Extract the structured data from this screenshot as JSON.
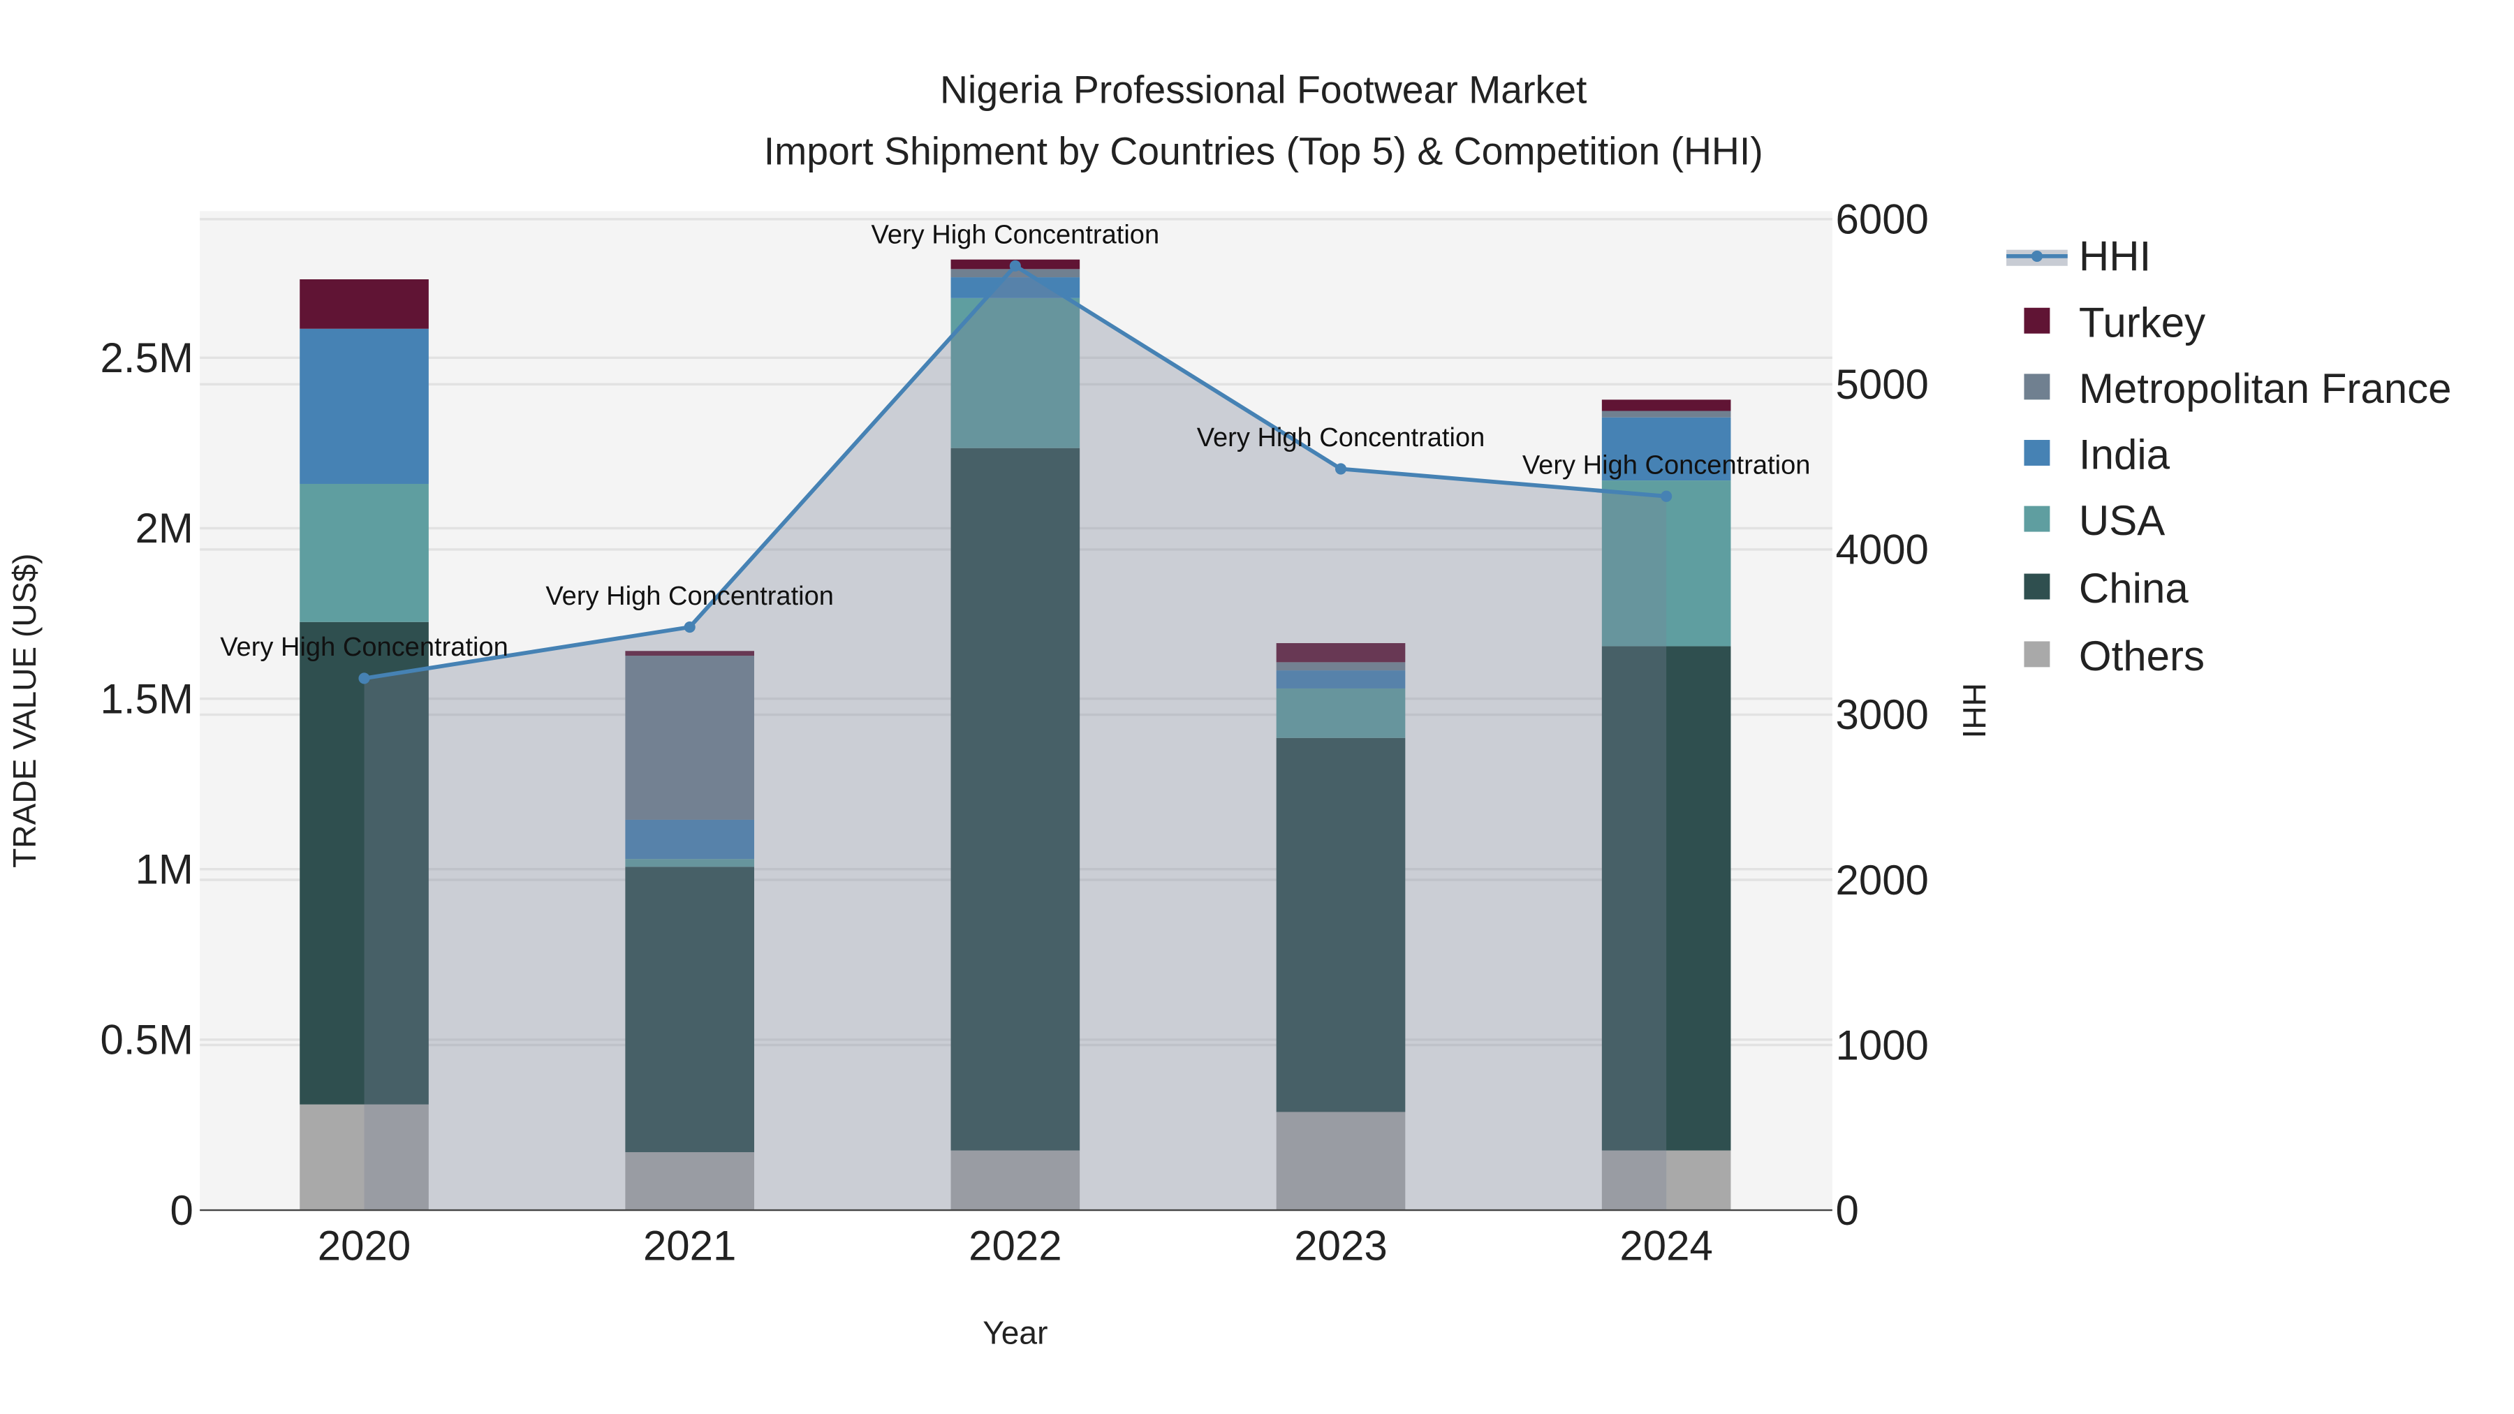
{
  "chart_data": {
    "type": "bar",
    "title_line1": "Nigeria Professional Footwear Market",
    "title_line2": "Import Shipment by Countries (Top 5) & Competition (HHI)",
    "xlabel": "Year",
    "ylabel": "TRADE VALUE (US$)",
    "y2label": "HHI",
    "categories": [
      "2020",
      "2021",
      "2022",
      "2023",
      "2024"
    ],
    "ylim": [
      0,
      2900000
    ],
    "y2lim": [
      0,
      6000
    ],
    "yticks": [
      {
        "v": 0,
        "label": "0"
      },
      {
        "v": 500000,
        "label": "0.5M"
      },
      {
        "v": 1000000,
        "label": "1M"
      },
      {
        "v": 1500000,
        "label": "1.5M"
      },
      {
        "v": 2000000,
        "label": "2M"
      },
      {
        "v": 2500000,
        "label": "2.5M"
      }
    ],
    "y2ticks": [
      {
        "v": 0,
        "label": "0"
      },
      {
        "v": 1000,
        "label": "1000"
      },
      {
        "v": 2000,
        "label": "2000"
      },
      {
        "v": 3000,
        "label": "3000"
      },
      {
        "v": 4000,
        "label": "4000"
      },
      {
        "v": 5000,
        "label": "5000"
      },
      {
        "v": 6000,
        "label": "6000"
      }
    ],
    "series": [
      {
        "name": "Others",
        "color": "#a9a9a9",
        "values": [
          310000,
          170000,
          175000,
          288000,
          175000
        ]
      },
      {
        "name": "China",
        "color": "#2f4f4f",
        "values": [
          1415000,
          837000,
          2060000,
          1097000,
          1479000
        ]
      },
      {
        "name": "USA",
        "color": "#5f9ea0",
        "values": [
          405000,
          23000,
          440000,
          145000,
          486000
        ]
      },
      {
        "name": "India",
        "color": "#4682b4",
        "values": [
          455000,
          115000,
          61000,
          53000,
          185000
        ]
      },
      {
        "name": "Metropolitan France",
        "color": "#708090",
        "values": [
          0,
          481000,
          24000,
          24000,
          19000
        ]
      },
      {
        "name": "Turkey",
        "color": "#601434",
        "values": [
          145000,
          14000,
          28000,
          56000,
          33000
        ]
      }
    ],
    "hhi": {
      "name": "HHI",
      "color": "#4682b4",
      "values": [
        3220,
        3530,
        5717,
        4488,
        4322
      ]
    },
    "annotations": [
      "Very High Concentration",
      "Very High Concentration",
      "Very High Concentration",
      "Very High Concentration",
      "Very High Concentration"
    ],
    "legend": [
      "HHI",
      "Turkey",
      "Metropolitan France",
      "India",
      "USA",
      "China",
      "Others"
    ],
    "legend_position": "right",
    "grid": true
  }
}
